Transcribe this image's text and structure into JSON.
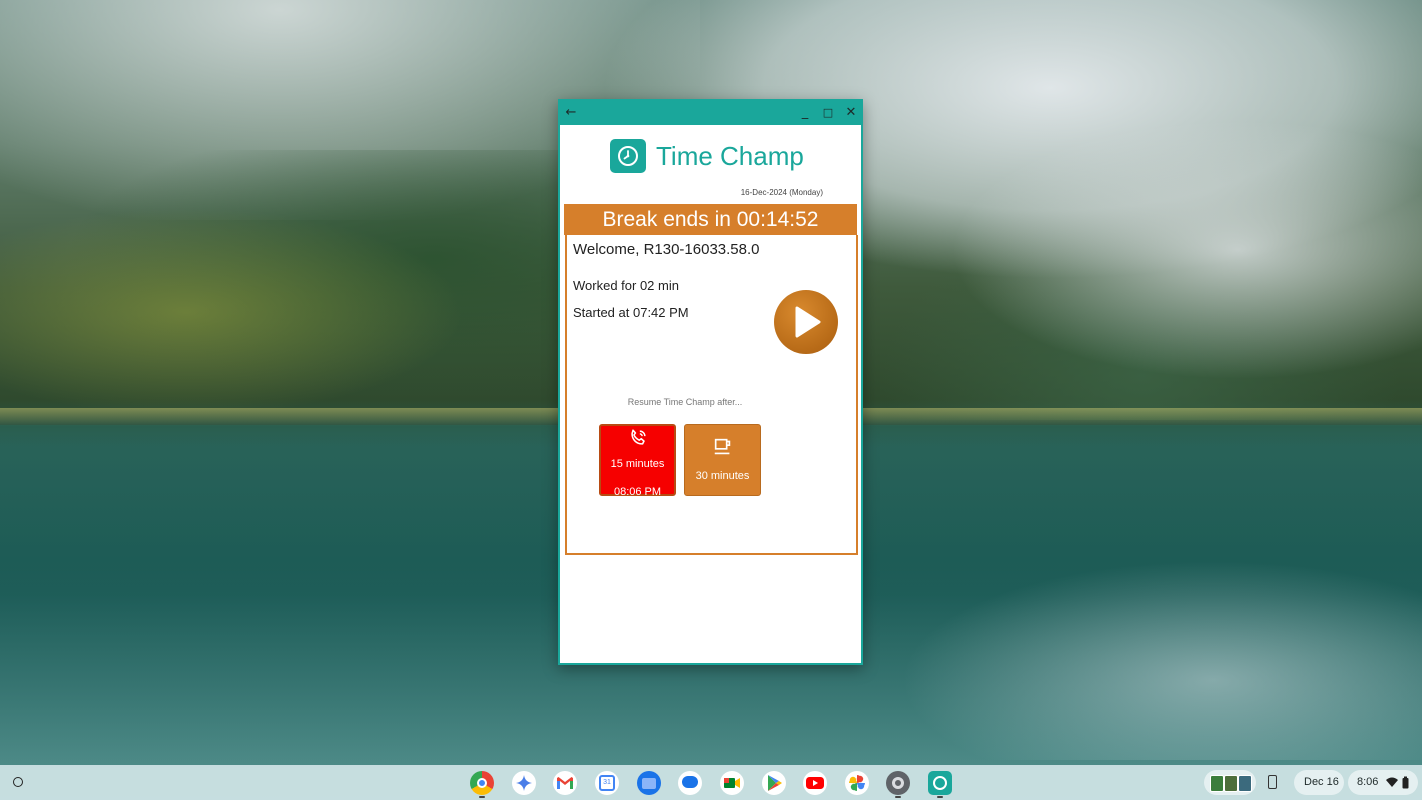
{
  "window": {
    "back_glyph": "←",
    "minimize_glyph": "_",
    "maximize_glyph": "□",
    "close_glyph": "✕"
  },
  "app": {
    "name": "Time Champ",
    "date": "16-Dec-2024 (Monday)",
    "break_banner": "Break ends in 00:14:52",
    "welcome": "Welcome, R130-16033.58.0",
    "worked": "Worked for  02 min",
    "started": "Started at 07:42 PM",
    "resume_text": "Resume Time Champ after...",
    "options": [
      {
        "label": "15 minutes",
        "time": "08:06 PM",
        "icon": "phone-icon",
        "color": "#f60000"
      },
      {
        "label": "30 minutes",
        "icon": "coffee-cup-icon",
        "color": "#d67f2b"
      }
    ],
    "accent": "#1aa79b",
    "break_color": "#d67f2b"
  },
  "taskbar": {
    "apps": [
      "chrome",
      "gemini",
      "gmail",
      "calendar",
      "files",
      "messages",
      "meet",
      "play-store",
      "youtube",
      "photos",
      "settings",
      "time-champ"
    ],
    "calendar_day": "31",
    "date": "Dec 16",
    "time": "8:06"
  }
}
